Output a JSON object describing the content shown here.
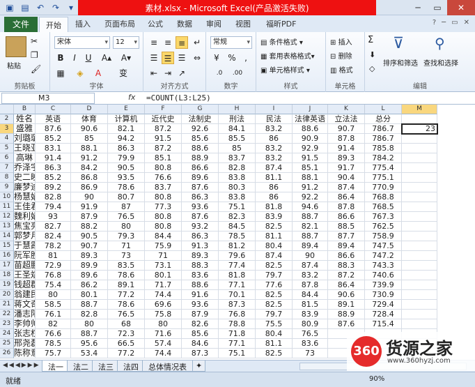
{
  "window": {
    "title": "素材.xlsx - Microsoft Excel(产品激活失败)",
    "colors": {
      "title_bar": "#ee1111",
      "file_tab": "#2a6e36",
      "selection_header": "#f9d77e"
    }
  },
  "ribbon": {
    "file_tab": "文件",
    "tabs": [
      "开始",
      "插入",
      "页面布局",
      "公式",
      "数据",
      "审阅",
      "视图",
      "福昕PDF"
    ],
    "active_tab": "开始",
    "groups": {
      "clipboard": {
        "label": "剪贴板",
        "paste": "粘贴"
      },
      "font": {
        "label": "字体",
        "font_name": "宋体",
        "font_size": "12",
        "bold": "B",
        "italic": "I",
        "underline": "U",
        "wen": "变"
      },
      "alignment": {
        "label": "对齐方式"
      },
      "number": {
        "label": "数字",
        "format": "常规",
        "percent": "%",
        "comma": ","
      },
      "styles": {
        "label": "样式",
        "conditional": "条件格式",
        "table": "套用表格格式",
        "cell_styles": "单元格样式"
      },
      "cells": {
        "label": "单元格",
        "insert": "插入",
        "delete": "删除",
        "format": "格式"
      },
      "editing": {
        "label": "编辑",
        "sum": "Σ",
        "sort": "排序和筛选",
        "find": "查找和选择"
      }
    }
  },
  "formula_bar": {
    "name_box": "M3",
    "fx": "fx",
    "formula": "=COUNT(L3:L25)"
  },
  "grid": {
    "columns": [
      "B",
      "C",
      "D",
      "E",
      "F",
      "G",
      "H",
      "I",
      "J",
      "K",
      "L",
      "M"
    ],
    "header_row": [
      "姓名",
      "英语",
      "体育",
      "计算机",
      "近代史",
      "法制史",
      "刑法",
      "民法",
      "法律英语",
      "立法法",
      "总分"
    ],
    "rows": [
      {
        "r": "3",
        "v": [
          "盛雅",
          "87.6",
          "90.6",
          "82.1",
          "87.2",
          "92.6",
          "84.1",
          "83.2",
          "88.6",
          "90.7",
          "786.7"
        ]
      },
      {
        "r": "4",
        "v": [
          "刘璐璐",
          "85.2",
          "85",
          "94.2",
          "91.5",
          "85.6",
          "85.5",
          "86",
          "90.9",
          "87.8",
          "786.7"
        ]
      },
      {
        "r": "5",
        "v": [
          "王晓亚",
          "83.1",
          "88.1",
          "86.3",
          "87.2",
          "88.6",
          "85",
          "83.2",
          "92.9",
          "91.4",
          "785.8"
        ]
      },
      {
        "r": "6",
        "v": [
          "高琳",
          "91.4",
          "91.2",
          "79.9",
          "85.1",
          "88.9",
          "83.7",
          "83.2",
          "91.5",
          "89.3",
          "784.2"
        ]
      },
      {
        "r": "7",
        "v": [
          "乔泽宇",
          "86.3",
          "84.2",
          "90.5",
          "80.8",
          "86.6",
          "82.8",
          "87.4",
          "85.1",
          "91.7",
          "775.4"
        ]
      },
      {
        "r": "8",
        "v": [
          "史二映",
          "85.2",
          "86.8",
          "93.5",
          "76.6",
          "89.6",
          "83.8",
          "81.1",
          "88.1",
          "90.4",
          "775.1"
        ]
      },
      {
        "r": "9",
        "v": [
          "廉梦迪",
          "89.2",
          "86.9",
          "78.6",
          "83.7",
          "87.6",
          "80.3",
          "86",
          "91.2",
          "87.4",
          "770.9"
        ]
      },
      {
        "r": "10",
        "v": [
          "杨慧娟",
          "82.8",
          "90",
          "80.7",
          "80.8",
          "86.3",
          "83.8",
          "86",
          "92.2",
          "86.4",
          "768.8"
        ]
      },
      {
        "r": "11",
        "v": [
          "王佳君",
          "79.4",
          "91.9",
          "87",
          "77.3",
          "93.6",
          "75.1",
          "81.8",
          "94.6",
          "87.8",
          "768.5"
        ]
      },
      {
        "r": "12",
        "v": [
          "魏利娟",
          "93",
          "87.9",
          "76.5",
          "80.8",
          "87.6",
          "82.3",
          "83.9",
          "88.7",
          "86.6",
          "767.3"
        ]
      },
      {
        "r": "13",
        "v": [
          "焦宝亮",
          "82.7",
          "88.2",
          "80",
          "80.8",
          "93.2",
          "84.5",
          "82.5",
          "82.1",
          "88.5",
          "762.5"
        ]
      },
      {
        "r": "14",
        "v": [
          "郭梦月",
          "82.4",
          "90.5",
          "79.3",
          "84.4",
          "86.3",
          "78.5",
          "81.1",
          "88.7",
          "87.7",
          "758.9"
        ]
      },
      {
        "r": "15",
        "v": [
          "于慧霞",
          "78.2",
          "90.7",
          "71",
          "75.9",
          "91.3",
          "81.2",
          "80.4",
          "89.4",
          "89.4",
          "747.5"
        ]
      },
      {
        "r": "16",
        "v": [
          "阮军胜",
          "81",
          "89.3",
          "73",
          "71",
          "89.3",
          "79.6",
          "87.4",
          "90",
          "86.6",
          "747.2"
        ]
      },
      {
        "r": "17",
        "v": [
          "苗超鹏",
          "72.9",
          "89.9",
          "83.5",
          "73.1",
          "88.3",
          "77.4",
          "82.5",
          "87.4",
          "88.3",
          "743.3"
        ]
      },
      {
        "r": "18",
        "v": [
          "王圣斌",
          "76.8",
          "89.6",
          "78.6",
          "80.1",
          "83.6",
          "81.8",
          "79.7",
          "83.2",
          "87.2",
          "740.6"
        ]
      },
      {
        "r": "19",
        "v": [
          "钱超群",
          "75.4",
          "86.2",
          "89.1",
          "71.7",
          "88.6",
          "77.1",
          "77.6",
          "87.8",
          "86.4",
          "739.9"
        ]
      },
      {
        "r": "20",
        "v": [
          "翁建民",
          "80",
          "80.1",
          "77.2",
          "74.4",
          "91.6",
          "70.1",
          "82.5",
          "84.4",
          "90.6",
          "730.9"
        ]
      },
      {
        "r": "21",
        "v": [
          "蒋文奇",
          "58.5",
          "88.7",
          "78.6",
          "69.6",
          "93.6",
          "87.3",
          "82.5",
          "81.5",
          "89.1",
          "729.4"
        ]
      },
      {
        "r": "22",
        "v": [
          "潘志阳",
          "76.1",
          "82.8",
          "76.5",
          "75.8",
          "87.9",
          "76.8",
          "79.7",
          "83.9",
          "88.9",
          "728.4"
        ]
      },
      {
        "r": "23",
        "v": [
          "李帅帅",
          "82",
          "80",
          "68",
          "80",
          "82.6",
          "78.8",
          "75.5",
          "80.9",
          "87.6",
          "715.4"
        ]
      },
      {
        "r": "24",
        "v": [
          "张志权",
          "76.6",
          "88.7",
          "72.3",
          "71.6",
          "85.6",
          "71.8",
          "80.4",
          "76.5",
          "",
          ""
        ]
      },
      {
        "r": "25",
        "v": [
          "邢尧磊",
          "78.5",
          "95.6",
          "66.5",
          "57.4",
          "84.6",
          "77.1",
          "81.1",
          "83.6",
          "",
          ""
        ]
      },
      {
        "r": "26",
        "v": [
          "陈称意",
          "75.7",
          "53.4",
          "77.2",
          "74.4",
          "87.3",
          "75.1",
          "82.5",
          "73",
          "",
          ""
        ]
      }
    ],
    "active_cell": {
      "ref": "M3",
      "value": "23"
    }
  },
  "sheets": [
    "法一",
    "法二",
    "法三",
    "法四",
    "总体情况表"
  ],
  "active_sheet": "法一",
  "status": {
    "ready": "就绪",
    "zoom": "90%"
  },
  "watermark": {
    "badge": "360",
    "brand": "货源之家",
    "url": "www.360hyzj.com"
  }
}
